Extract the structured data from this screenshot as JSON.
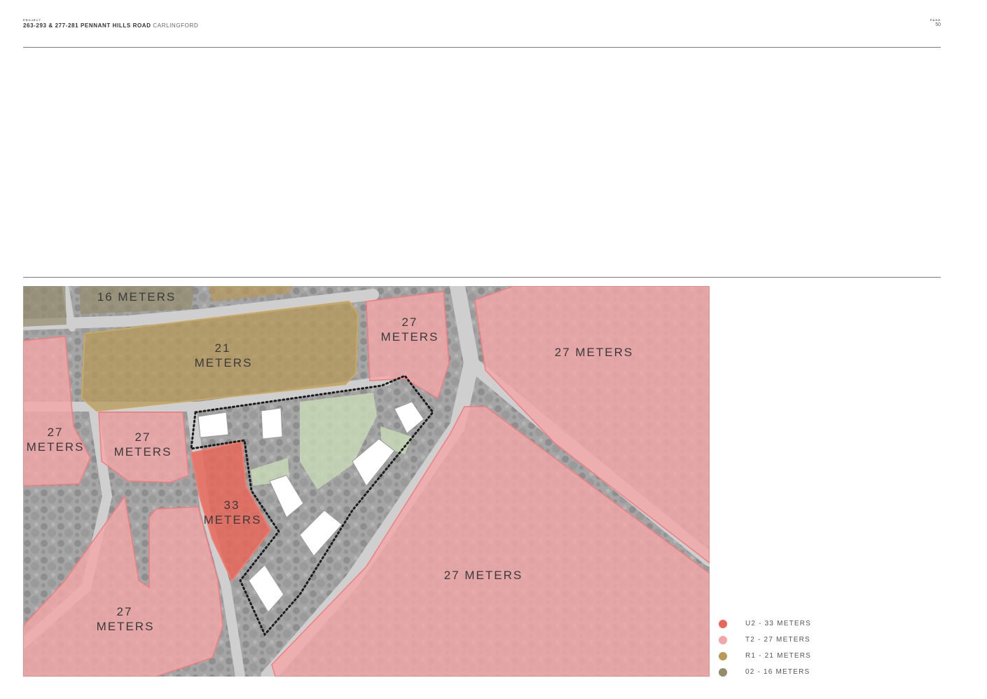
{
  "header": {
    "project_label": "PROJECT",
    "project_title": "263-293 & 277-281 PENNANT HILLS ROAD",
    "project_location": "CARLINGFORD",
    "page_label": "PAGE",
    "page_number": "50"
  },
  "map": {
    "zone_labels": {
      "top_16": "16 METERS",
      "r1_a": "21",
      "r1_b": "METERS",
      "top_mid_27_a": "27",
      "top_mid_27_b": "METERS",
      "top_right_27": "27 METERS",
      "left_27_a": "27",
      "left_27_b": "METERS",
      "mid_left_27_a": "27",
      "mid_left_27_b": "METERS",
      "site_33_a": "33",
      "site_33_b": "METERS",
      "bottom_left_27_a": "27",
      "bottom_left_27_b": "METERS",
      "bottom_right_27": "27 METERS"
    }
  },
  "legend": {
    "items": [
      {
        "label": "U2 - 33 METERS",
        "color": "#e8675a"
      },
      {
        "label": "T2 - 27 METERS",
        "color": "#f2a6a6"
      },
      {
        "label": "R1 - 21 METERS",
        "color": "#b8995a"
      },
      {
        "label": "02 - 16 METERS",
        "color": "#948b6c"
      }
    ]
  },
  "colors": {
    "u2": "#e8675a",
    "t2": "#f2a6a6",
    "r1": "#b8995a",
    "o2": "#948b6c",
    "open_space": "#c9dcb8"
  }
}
